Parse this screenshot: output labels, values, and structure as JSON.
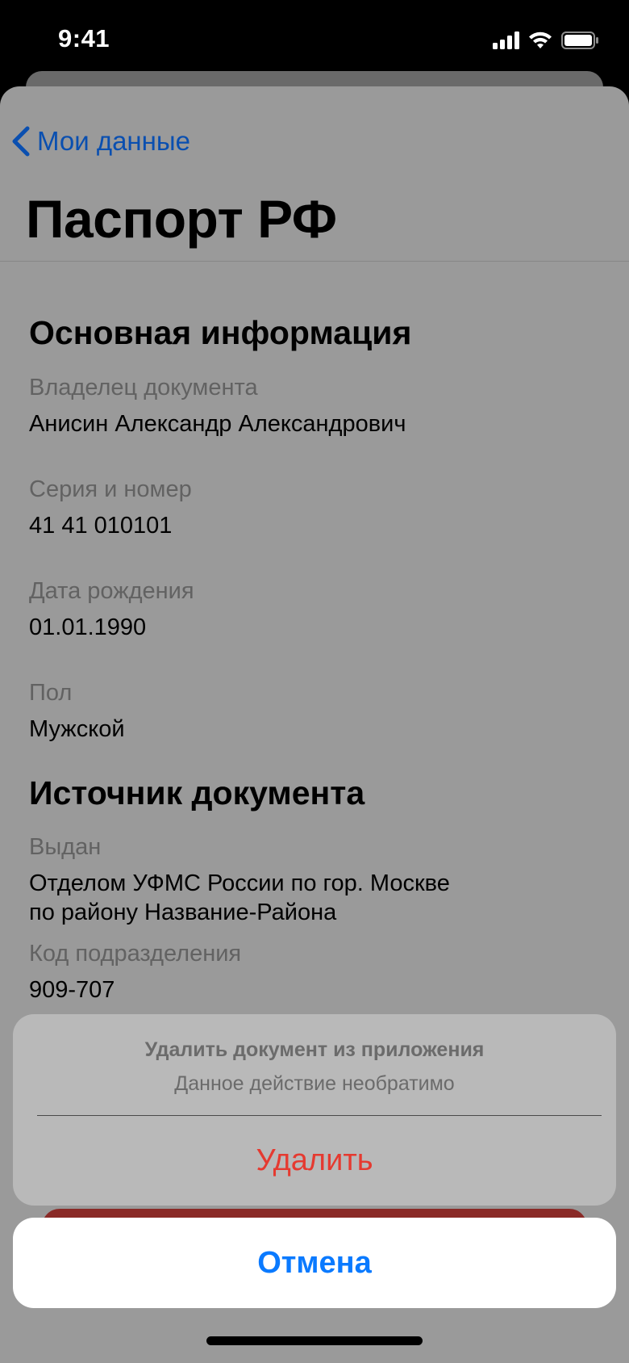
{
  "status_bar": {
    "time": "9:41"
  },
  "nav": {
    "back_label": "Мои данные"
  },
  "page": {
    "title": "Паспорт РФ"
  },
  "basic_info": {
    "title": "Основная информация",
    "fields": [
      {
        "label": "Владелец документа",
        "value": "Анисин Александр Александрович"
      },
      {
        "label": "Серия и номер",
        "value": "41 41 010101"
      },
      {
        "label": "Дата рождения",
        "value": "01.01.1990"
      },
      {
        "label": "Пол",
        "value": "Мужской"
      }
    ]
  },
  "source": {
    "title": "Источник документа",
    "issued_label": "Выдан",
    "issued_lines": [
      "Отделом УФМС России по гор. Москве",
      "по району Название-Района"
    ],
    "code_label": "Код подразделения",
    "code_value": "909-707"
  },
  "action_sheet": {
    "title": "Удалить документ из приложения",
    "message": "Данное действие необратимо",
    "delete_label": "Удалить",
    "cancel_label": "Отмена"
  },
  "colors": {
    "link_blue": "#0a4fb0",
    "cancel_blue": "#0a7aff",
    "destructive_red": "#e53a30"
  }
}
